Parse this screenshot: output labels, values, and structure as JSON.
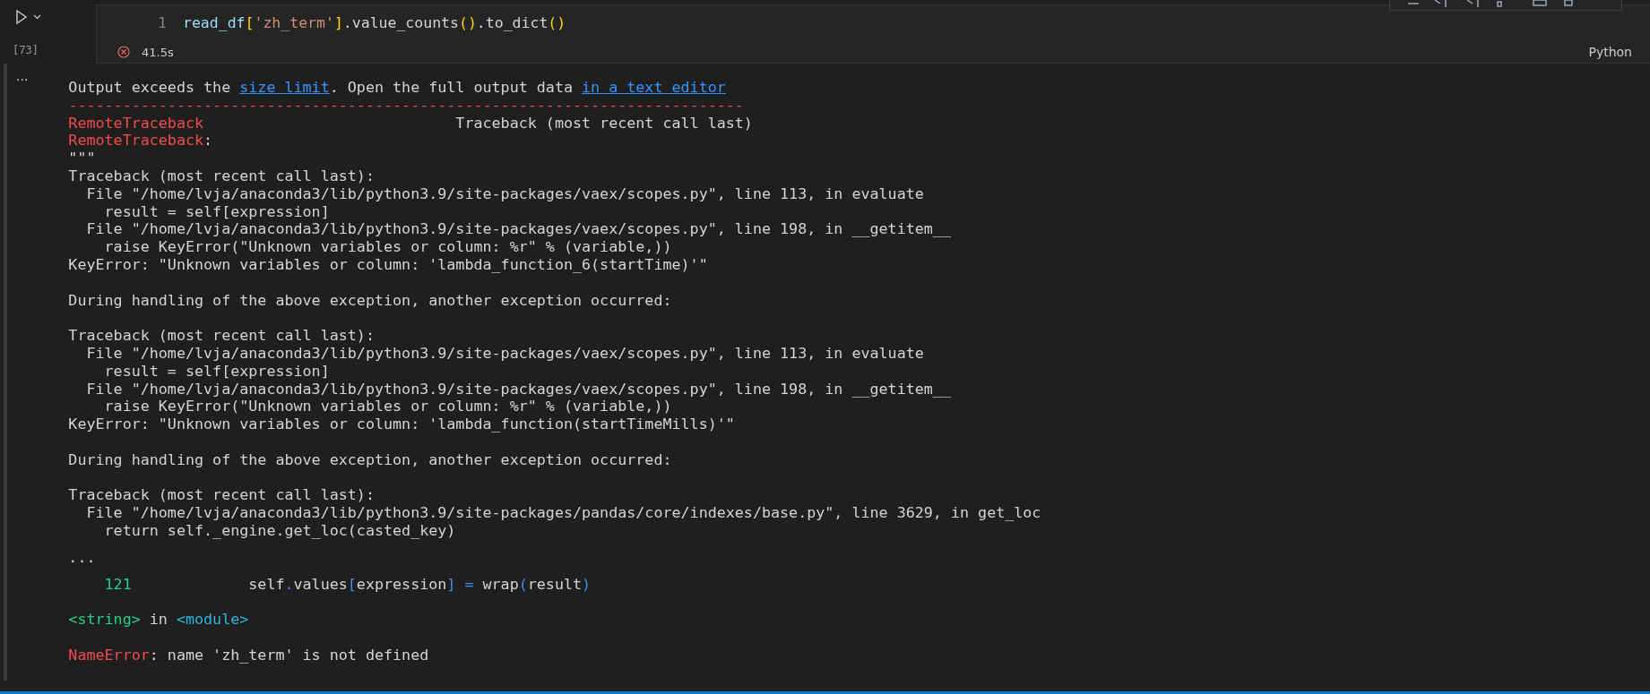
{
  "cell": {
    "execution_count": "[73]",
    "line_number": "1",
    "code": [
      {
        "text": "read_df",
        "kind": "var"
      },
      {
        "text": "[",
        "kind": "bracket"
      },
      {
        "text": "'zh_term'",
        "kind": "string"
      },
      {
        "text": "]",
        "kind": "bracket"
      },
      {
        "text": ".value_counts",
        "kind": "plain"
      },
      {
        "text": "()",
        "kind": "bracket"
      },
      {
        "text": ".to_dict",
        "kind": "plain"
      },
      {
        "text": "()",
        "kind": "bracket"
      }
    ],
    "has_error": true,
    "duration": "41.5s",
    "language": "Python"
  },
  "output": {
    "more": "...",
    "lines": [
      {
        "kind": "text",
        "segments": [
          {
            "text": "Output exceeds the ",
            "kind": "plain"
          },
          {
            "text": "size limit",
            "kind": "link"
          },
          {
            "text": ". Open the full output data ",
            "kind": "plain"
          },
          {
            "text": "in a text editor",
            "kind": "link"
          }
        ]
      },
      {
        "kind": "text",
        "segments": [
          {
            "text": "---------------------------------------------------------------------------",
            "kind": "error"
          }
        ]
      },
      {
        "kind": "text",
        "segments": [
          {
            "text": "RemoteTraceback",
            "kind": "error"
          },
          {
            "text": "                            Traceback (most recent call last)",
            "kind": "plain"
          }
        ]
      },
      {
        "kind": "text",
        "segments": [
          {
            "text": "RemoteTraceback",
            "kind": "error"
          },
          {
            "text": ":",
            "kind": "plain"
          }
        ]
      },
      {
        "kind": "text",
        "segments": [
          {
            "text": "\"\"\"",
            "kind": "plain"
          }
        ]
      },
      {
        "kind": "text",
        "segments": [
          {
            "text": "Traceback (most recent call last):",
            "kind": "plain"
          }
        ]
      },
      {
        "kind": "text",
        "segments": [
          {
            "text": "  File \"/home/lvja/anaconda3/lib/python3.9/site-packages/vaex/scopes.py\", line 113, in evaluate",
            "kind": "plain"
          }
        ]
      },
      {
        "kind": "text",
        "segments": [
          {
            "text": "    result = self[expression]",
            "kind": "plain"
          }
        ]
      },
      {
        "kind": "text",
        "segments": [
          {
            "text": "  File \"/home/lvja/anaconda3/lib/python3.9/site-packages/vaex/scopes.py\", line 198, in __getitem__",
            "kind": "plain"
          }
        ]
      },
      {
        "kind": "text",
        "segments": [
          {
            "text": "    raise KeyError(\"Unknown variables or column: %r\" % (variable,))",
            "kind": "plain"
          }
        ]
      },
      {
        "kind": "text",
        "segments": [
          {
            "text": "KeyError: \"Unknown variables or column: 'lambda_function_6(startTime)'\"",
            "kind": "plain"
          }
        ]
      },
      {
        "kind": "blank"
      },
      {
        "kind": "text",
        "segments": [
          {
            "text": "During handling of the above exception, another exception occurred:",
            "kind": "plain"
          }
        ]
      },
      {
        "kind": "blank"
      },
      {
        "kind": "text",
        "segments": [
          {
            "text": "Traceback (most recent call last):",
            "kind": "plain"
          }
        ]
      },
      {
        "kind": "text",
        "segments": [
          {
            "text": "  File \"/home/lvja/anaconda3/lib/python3.9/site-packages/vaex/scopes.py\", line 113, in evaluate",
            "kind": "plain"
          }
        ]
      },
      {
        "kind": "text",
        "segments": [
          {
            "text": "    result = self[expression]",
            "kind": "plain"
          }
        ]
      },
      {
        "kind": "text",
        "segments": [
          {
            "text": "  File \"/home/lvja/anaconda3/lib/python3.9/site-packages/vaex/scopes.py\", line 198, in __getitem__",
            "kind": "plain"
          }
        ]
      },
      {
        "kind": "text",
        "segments": [
          {
            "text": "    raise KeyError(\"Unknown variables or column: %r\" % (variable,))",
            "kind": "plain"
          }
        ]
      },
      {
        "kind": "text",
        "segments": [
          {
            "text": "KeyError: \"Unknown variables or column: 'lambda_function(startTimeMills)'\"",
            "kind": "plain"
          }
        ]
      },
      {
        "kind": "blank"
      },
      {
        "kind": "text",
        "segments": [
          {
            "text": "During handling of the above exception, another exception occurred:",
            "kind": "plain"
          }
        ]
      },
      {
        "kind": "blank"
      },
      {
        "kind": "text",
        "segments": [
          {
            "text": "Traceback (most recent call last):",
            "kind": "plain"
          }
        ]
      },
      {
        "kind": "text",
        "segments": [
          {
            "text": "  File \"/home/lvja/anaconda3/lib/python3.9/site-packages/pandas/core/indexes/base.py\", line 3629, in get_loc",
            "kind": "plain"
          }
        ]
      },
      {
        "kind": "text",
        "segments": [
          {
            "text": "    return self._engine.get_loc(casted_key)",
            "kind": "plain"
          }
        ]
      },
      {
        "kind": "excerpt",
        "segments": [
          {
            "text": "...",
            "kind": "plain"
          }
        ]
      },
      {
        "kind": "excerpt",
        "segments": [
          {
            "text": "    121",
            "kind": "number"
          },
          {
            "text": "             self",
            "kind": "plain"
          },
          {
            "text": ".",
            "kind": "blue"
          },
          {
            "text": "values",
            "kind": "plain"
          },
          {
            "text": "[",
            "kind": "blue"
          },
          {
            "text": "expression",
            "kind": "plain"
          },
          {
            "text": "]",
            "kind": "blue"
          },
          {
            "text": " = ",
            "kind": "blue"
          },
          {
            "text": "wrap",
            "kind": "plain"
          },
          {
            "text": "(",
            "kind": "blue"
          },
          {
            "text": "result",
            "kind": "plain"
          },
          {
            "text": ")",
            "kind": "blue"
          }
        ]
      },
      {
        "kind": "blank"
      },
      {
        "kind": "text",
        "segments": [
          {
            "text": "<string>",
            "kind": "number"
          },
          {
            "text": " in ",
            "kind": "plain"
          },
          {
            "text": "<module>",
            "kind": "cyan"
          }
        ]
      },
      {
        "kind": "blank"
      },
      {
        "kind": "text",
        "segments": [
          {
            "text": "NameError",
            "kind": "error"
          },
          {
            "text": ": name 'zh_term' is not defined",
            "kind": "plain"
          }
        ]
      }
    ]
  }
}
